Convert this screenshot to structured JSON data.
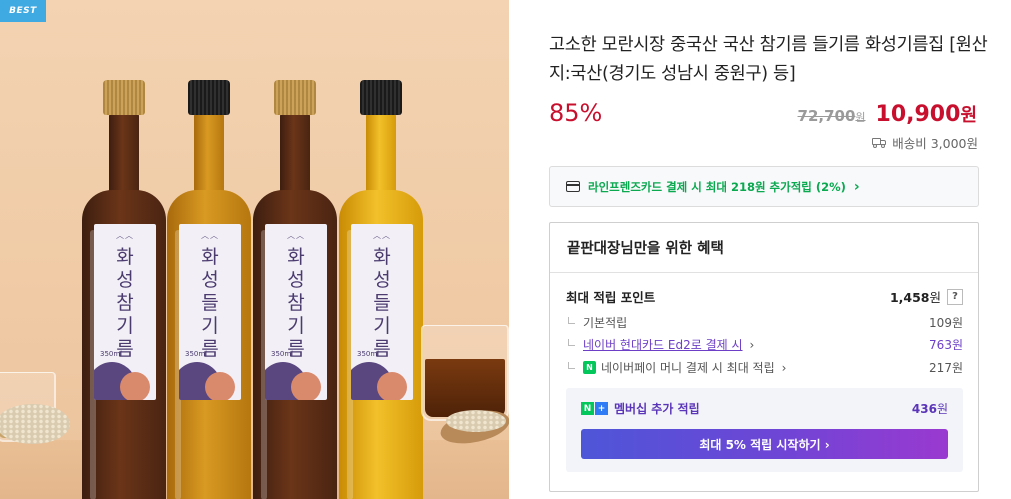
{
  "badge": "BEST",
  "product": {
    "title": "고소한 모란시장 중국산 국산 참기름 들기름 화성기름집 [원산지:국산(경기도 성남시 중원구) 등]",
    "discount": "85%",
    "original_price": "72,700",
    "original_unit": "원",
    "sale_price": "10,900",
    "sale_unit": "원",
    "shipping": "배송비 3,000원"
  },
  "bottles": [
    {
      "name": "화\n성\n참\n기\n름",
      "volume": "350ml"
    },
    {
      "name": "화\n성\n들\n기\n름",
      "volume": "350ml"
    },
    {
      "name": "화\n성\n참\n기\n름",
      "volume": "350ml"
    },
    {
      "name": "화\n성\n들\n기\n름",
      "volume": "350ml"
    }
  ],
  "card_banner": {
    "text": "라인프렌즈카드 결제 시 최대 218원 추가적립 (2%)",
    "chevron": "›"
  },
  "benefit": {
    "heading": "끝판대장님만을 위한 혜택",
    "max_label": "최대 적립 포인트",
    "max_amount": "1,458",
    "max_unit": "원",
    "help": "?",
    "rows": [
      {
        "label": "기본적립",
        "amount": "109원"
      },
      {
        "label": "네이버 현대카드 Ed2로 결제 시",
        "amount": "763원"
      },
      {
        "label": "네이버페이 머니 결제 시 최대 적립",
        "amount": "217원"
      }
    ],
    "npay_badge": "N",
    "member": {
      "n": "N",
      "plus": "+",
      "label": "멤버십 추가 적립",
      "amount": "436",
      "unit": "원",
      "cta": "최대 5% 적립 시작하기 ›"
    }
  },
  "colors": {
    "accent_red": "#c8102e",
    "green": "#0aa84f",
    "purple": "#6d3fc7",
    "badge_blue": "#3fa9e1"
  }
}
